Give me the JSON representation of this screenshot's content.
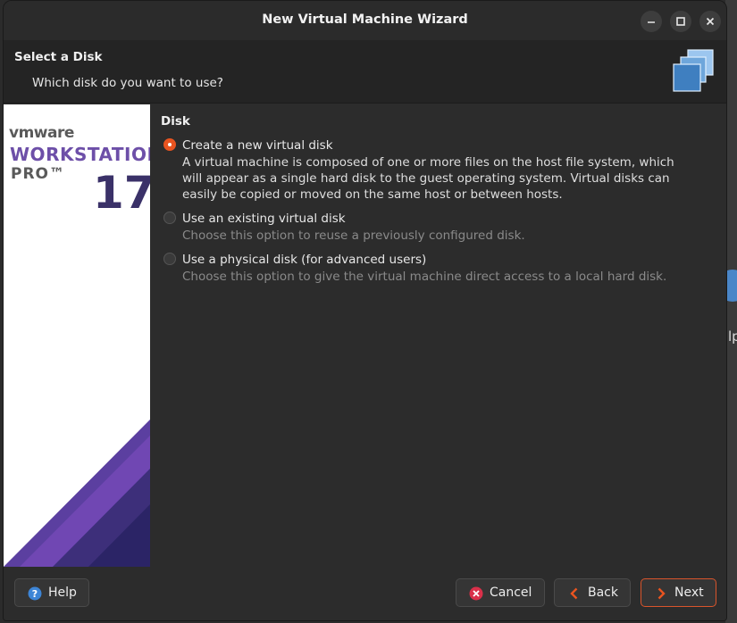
{
  "window": {
    "title": "New Virtual Machine Wizard"
  },
  "header": {
    "title": "Select a Disk",
    "subtitle": "Which disk do you want to use?"
  },
  "branding": {
    "vendor": "vmware",
    "product": "WORKSTATION",
    "edition": "PRO™",
    "version": "17"
  },
  "section": {
    "title": "Disk"
  },
  "options": [
    {
      "label": "Create a new virtual disk",
      "selected": true,
      "description": "A virtual machine is composed of one or more files on the host file system, which will appear as a single hard disk to the guest operating system. Virtual disks can easily be copied or moved on the same host or between hosts."
    },
    {
      "label": "Use an existing virtual disk",
      "selected": false,
      "description": "Choose this option to reuse a previously configured disk."
    },
    {
      "label": "Use a physical disk (for advanced users)",
      "selected": false,
      "description": "Choose this option to give the virtual machine direct access to a local hard disk."
    }
  ],
  "buttons": {
    "help": "Help",
    "cancel": "Cancel",
    "back": "Back",
    "next": "Next"
  },
  "background_peek": {
    "text": "lp"
  },
  "colors": {
    "accent": "#e95420",
    "purple": "#6d4fa8"
  }
}
